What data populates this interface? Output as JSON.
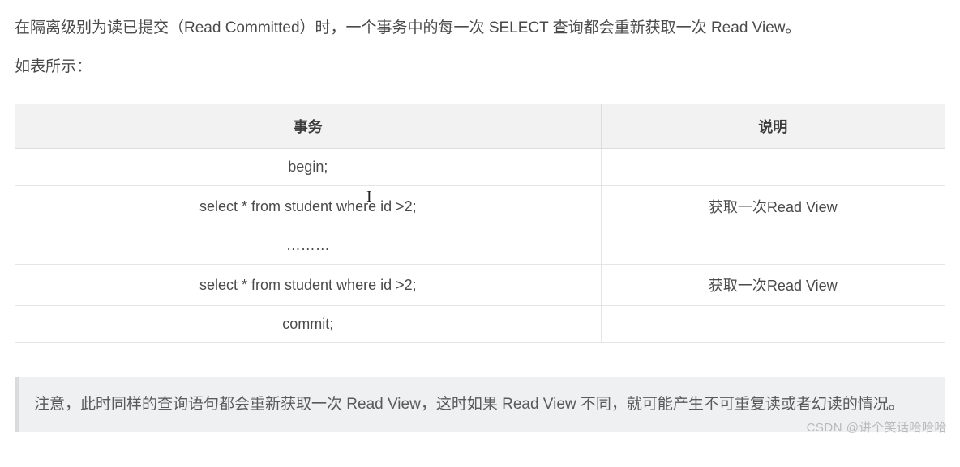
{
  "paragraphs": {
    "p1": "在隔离级别为读已提交（Read Committed）时，一个事务中的每一次 SELECT 查询都会重新获取一次 Read View。",
    "p2": "如表所示："
  },
  "table": {
    "headers": {
      "transaction": "事务",
      "description": "说明"
    },
    "rows": [
      {
        "transaction": "begin;",
        "description": ""
      },
      {
        "transaction": "select * from student where id >2;",
        "description": "获取一次Read View"
      },
      {
        "transaction": "………",
        "description": ""
      },
      {
        "transaction": "select * from student where id >2;",
        "description": "获取一次Read View"
      },
      {
        "transaction": "commit;",
        "description": ""
      }
    ]
  },
  "note": "注意，此时同样的查询语句都会重新获取一次 Read View，这时如果 Read View 不同，就可能产生不可重复读或者幻读的情况。",
  "watermark": "CSDN @讲个笑话哈哈哈"
}
